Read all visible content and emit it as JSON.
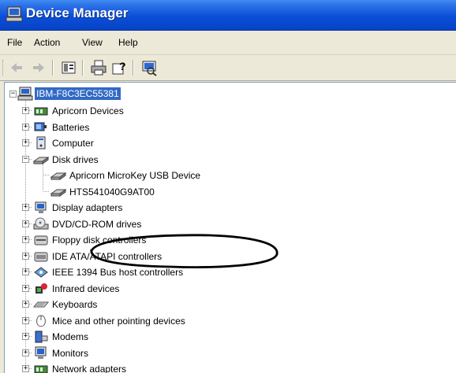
{
  "window": {
    "title": "Device Manager",
    "title_icon": "computer-icon"
  },
  "menu": [
    {
      "key": "file",
      "label": "File"
    },
    {
      "key": "action",
      "label": "Action"
    },
    {
      "key": "view",
      "label": "View"
    },
    {
      "key": "help",
      "label": "Help"
    }
  ],
  "toolbar": {
    "buttons": [
      "back-arrow-icon",
      "forward-arrow-icon",
      "properties-icon",
      "print-icon",
      "help-icon",
      "scan-hardware-icon"
    ]
  },
  "tree": {
    "root": {
      "label": "IBM-F8C3EC55381",
      "expanded": true,
      "selected": true
    },
    "categories": [
      {
        "label": "Apricorn Devices",
        "expanded": false,
        "icon": "apricorn-device-icon"
      },
      {
        "label": "Batteries",
        "expanded": false,
        "icon": "battery-icon"
      },
      {
        "label": "Computer",
        "expanded": false,
        "icon": "computer-icon"
      },
      {
        "label": "Disk drives",
        "expanded": true,
        "icon": "disk-drive-icon",
        "children": [
          {
            "label": "Apricorn  MicroKey USB Device",
            "icon": "disk-drive-icon",
            "highlighted": true
          },
          {
            "label": "HTS541040G9AT00",
            "icon": "disk-drive-icon"
          }
        ]
      },
      {
        "label": "Display adapters",
        "expanded": false,
        "icon": "display-adapter-icon"
      },
      {
        "label": "DVD/CD-ROM drives",
        "expanded": false,
        "icon": "dvd-drive-icon"
      },
      {
        "label": "Floppy disk controllers",
        "expanded": false,
        "icon": "floppy-controller-icon"
      },
      {
        "label": "IDE ATA/ATAPI controllers",
        "expanded": false,
        "icon": "ide-controller-icon"
      },
      {
        "label": "IEEE 1394 Bus host controllers",
        "expanded": false,
        "icon": "ieee1394-icon"
      },
      {
        "label": "Infrared devices",
        "expanded": false,
        "icon": "infrared-icon"
      },
      {
        "label": "Keyboards",
        "expanded": false,
        "icon": "keyboard-icon"
      },
      {
        "label": "Mice and other pointing devices",
        "expanded": false,
        "icon": "mouse-icon"
      },
      {
        "label": "Modems",
        "expanded": false,
        "icon": "modem-icon"
      },
      {
        "label": "Monitors",
        "expanded": false,
        "icon": "monitor-icon"
      },
      {
        "label": "Network adapters",
        "expanded": false,
        "icon": "network-adapter-icon"
      }
    ]
  },
  "annotation": {
    "shape": "ellipse",
    "color": "#000000",
    "target": "Apricorn  MicroKey USB Device"
  }
}
